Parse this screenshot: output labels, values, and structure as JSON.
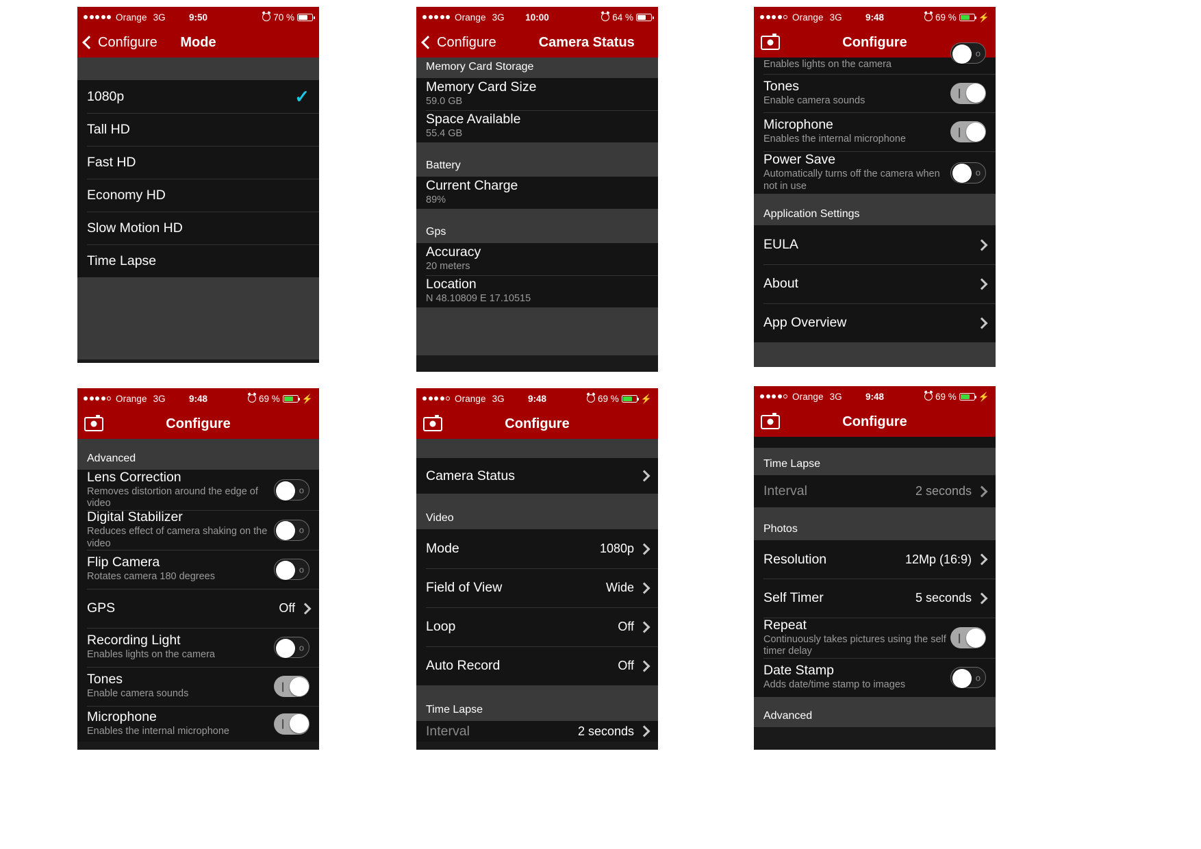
{
  "panels": [
    {
      "id": "mode",
      "status": {
        "carrier": "Orange",
        "network": "3G",
        "time": "9:50",
        "battery_pct": "70 %",
        "dots_filled": 5,
        "dots_hollow": 0,
        "battery_fill": 70,
        "battery_green": false,
        "charging": false
      },
      "nav": {
        "type": "back",
        "back_label": "Configure",
        "title": "Mode"
      },
      "rows": [
        {
          "label": "1080p",
          "checked": true
        },
        {
          "label": "Tall HD",
          "checked": false
        },
        {
          "label": "Fast HD",
          "checked": false
        },
        {
          "label": "Economy HD",
          "checked": false
        },
        {
          "label": "Slow Motion HD",
          "checked": false
        },
        {
          "label": "Time Lapse",
          "checked": false
        }
      ]
    },
    {
      "id": "camera-status",
      "status": {
        "carrier": "Orange",
        "network": "3G",
        "time": "10:00",
        "battery_pct": "64 %",
        "dots_filled": 5,
        "dots_hollow": 0,
        "battery_fill": 64,
        "battery_green": false,
        "charging": false
      },
      "nav": {
        "type": "back",
        "back_label": "Configure",
        "title": "Camera Status"
      },
      "sections": [
        {
          "header": "Memory Card Storage",
          "items": [
            {
              "title": "Memory Card Size",
              "sub": "59.0 GB"
            },
            {
              "title": "Space Available",
              "sub": "55.4 GB"
            }
          ]
        },
        {
          "header": "Battery",
          "items": [
            {
              "title": "Current Charge",
              "sub": "89%"
            }
          ]
        },
        {
          "header": "Gps",
          "items": [
            {
              "title": "Accuracy",
              "sub": "20 meters"
            },
            {
              "title": "Location",
              "sub": "N 48.10809 E 17.10515"
            }
          ]
        }
      ]
    },
    {
      "id": "configure-scrolled",
      "status": {
        "carrier": "Orange",
        "network": "3G",
        "time": "9:48",
        "battery_pct": "69 %",
        "dots_filled": 4,
        "dots_hollow": 1,
        "battery_fill": 69,
        "battery_green": true,
        "charging": true
      },
      "nav": {
        "type": "camera",
        "title": "Configure"
      },
      "partial_row": {
        "sub": "Enables lights on the camera",
        "toggle": "off"
      },
      "toggles": [
        {
          "title": "Tones",
          "sub": "Enable camera sounds",
          "toggle": "on"
        },
        {
          "title": "Microphone",
          "sub": "Enables the internal microphone",
          "toggle": "on"
        },
        {
          "title": "Power Save",
          "sub": "Automatically turns off the camera when not in use",
          "toggle": "off"
        }
      ],
      "section_header": "Application Settings",
      "links": [
        {
          "label": "EULA"
        },
        {
          "label": "About"
        },
        {
          "label": "App Overview"
        }
      ]
    },
    {
      "id": "configure-advanced",
      "status": {
        "carrier": "Orange",
        "network": "3G",
        "time": "9:48",
        "battery_pct": "69 %",
        "dots_filled": 4,
        "dots_hollow": 1,
        "battery_fill": 69,
        "battery_green": true,
        "charging": true
      },
      "nav": {
        "type": "camera",
        "title": "Configure"
      },
      "section_header": "Advanced",
      "rows": [
        {
          "kind": "toggle",
          "title": "Lens Correction",
          "sub": "Removes distortion around the edge of video",
          "toggle": "off"
        },
        {
          "kind": "toggle",
          "title": "Digital Stabilizer",
          "sub": "Reduces effect of camera shaking on the video",
          "toggle": "off"
        },
        {
          "kind": "toggle",
          "title": "Flip Camera",
          "sub": "Rotates camera 180 degrees",
          "toggle": "off"
        },
        {
          "kind": "value",
          "title": "GPS",
          "value": "Off"
        },
        {
          "kind": "toggle",
          "title": "Recording Light",
          "sub": "Enables lights on the camera",
          "toggle": "off"
        },
        {
          "kind": "toggle",
          "title": "Tones",
          "sub": "Enable camera sounds",
          "toggle": "on"
        },
        {
          "kind": "toggle",
          "title": "Microphone",
          "sub": "Enables the internal microphone",
          "toggle": "on"
        }
      ]
    },
    {
      "id": "configure-video",
      "status": {
        "carrier": "Orange",
        "network": "3G",
        "time": "9:48",
        "battery_pct": "69 %",
        "dots_filled": 4,
        "dots_hollow": 1,
        "battery_fill": 69,
        "battery_green": true,
        "charging": true
      },
      "nav": {
        "type": "camera",
        "title": "Configure"
      },
      "top_row": {
        "label": "Camera Status"
      },
      "section_header": "Video",
      "rows": [
        {
          "label": "Mode",
          "value": "1080p"
        },
        {
          "label": "Field of View",
          "value": "Wide"
        },
        {
          "label": "Loop",
          "value": "Off"
        },
        {
          "label": "Auto Record",
          "value": "Off"
        }
      ],
      "section_header_2": "Time Lapse",
      "cut_row": {
        "label": "Interval",
        "value": "2 seconds"
      }
    },
    {
      "id": "configure-photos",
      "status": {
        "carrier": "Orange",
        "network": "3G",
        "time": "9:48",
        "battery_pct": "69 %",
        "dots_filled": 4,
        "dots_hollow": 1,
        "battery_fill": 69,
        "battery_green": true,
        "charging": true
      },
      "nav": {
        "type": "camera",
        "title": "Configure"
      },
      "section_header": "Time Lapse",
      "interval_row": {
        "label": "Interval",
        "value": "2 seconds",
        "disabled": true
      },
      "section_header_2": "Photos",
      "rows": [
        {
          "kind": "value",
          "label": "Resolution",
          "value": "12Mp (16:9)"
        },
        {
          "kind": "value",
          "label": "Self Timer",
          "value": "5 seconds"
        },
        {
          "kind": "toggle",
          "title": "Repeat",
          "sub": "Continuously takes pictures using the self timer delay",
          "toggle": "on"
        },
        {
          "kind": "toggle",
          "title": "Date Stamp",
          "sub": "Adds date/time stamp to images",
          "toggle": "off"
        }
      ],
      "section_header_3": "Advanced"
    }
  ]
}
